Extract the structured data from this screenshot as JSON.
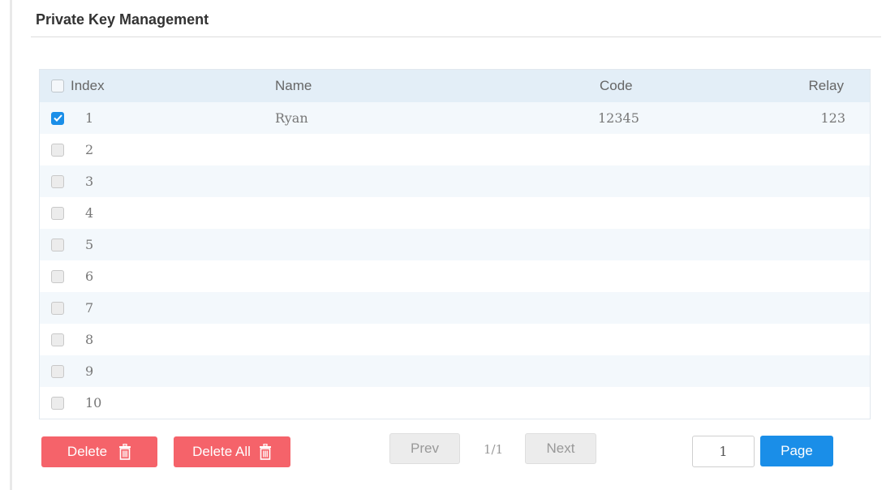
{
  "page": {
    "title": "Private Key Management"
  },
  "table": {
    "columns": {
      "index": "Index",
      "name": "Name",
      "code": "Code",
      "relay": "Relay"
    },
    "rows": [
      {
        "index": "1",
        "name": "Ryan",
        "code": "12345",
        "relay": "123",
        "checked": true
      },
      {
        "index": "2",
        "name": "",
        "code": "",
        "relay": "",
        "checked": false
      },
      {
        "index": "3",
        "name": "",
        "code": "",
        "relay": "",
        "checked": false
      },
      {
        "index": "4",
        "name": "",
        "code": "",
        "relay": "",
        "checked": false
      },
      {
        "index": "5",
        "name": "",
        "code": "",
        "relay": "",
        "checked": false
      },
      {
        "index": "6",
        "name": "",
        "code": "",
        "relay": "",
        "checked": false
      },
      {
        "index": "7",
        "name": "",
        "code": "",
        "relay": "",
        "checked": false
      },
      {
        "index": "8",
        "name": "",
        "code": "",
        "relay": "",
        "checked": false
      },
      {
        "index": "9",
        "name": "",
        "code": "",
        "relay": "",
        "checked": false
      },
      {
        "index": "10",
        "name": "",
        "code": "",
        "relay": "",
        "checked": false
      }
    ]
  },
  "actions": {
    "delete_label": "Delete",
    "delete_all_label": "Delete All"
  },
  "pagination": {
    "prev_label": "Prev",
    "page_count": "1/1",
    "next_label": "Next",
    "page_input_value": "1",
    "page_button_label": "Page"
  },
  "icons": {
    "trash": "trash-icon",
    "check": "checkmark-icon"
  },
  "colors": {
    "accent": "#1a8ee8",
    "danger": "#f5636a",
    "header_bg": "#e3eef7",
    "stripe_bg": "#f3f8fc"
  }
}
